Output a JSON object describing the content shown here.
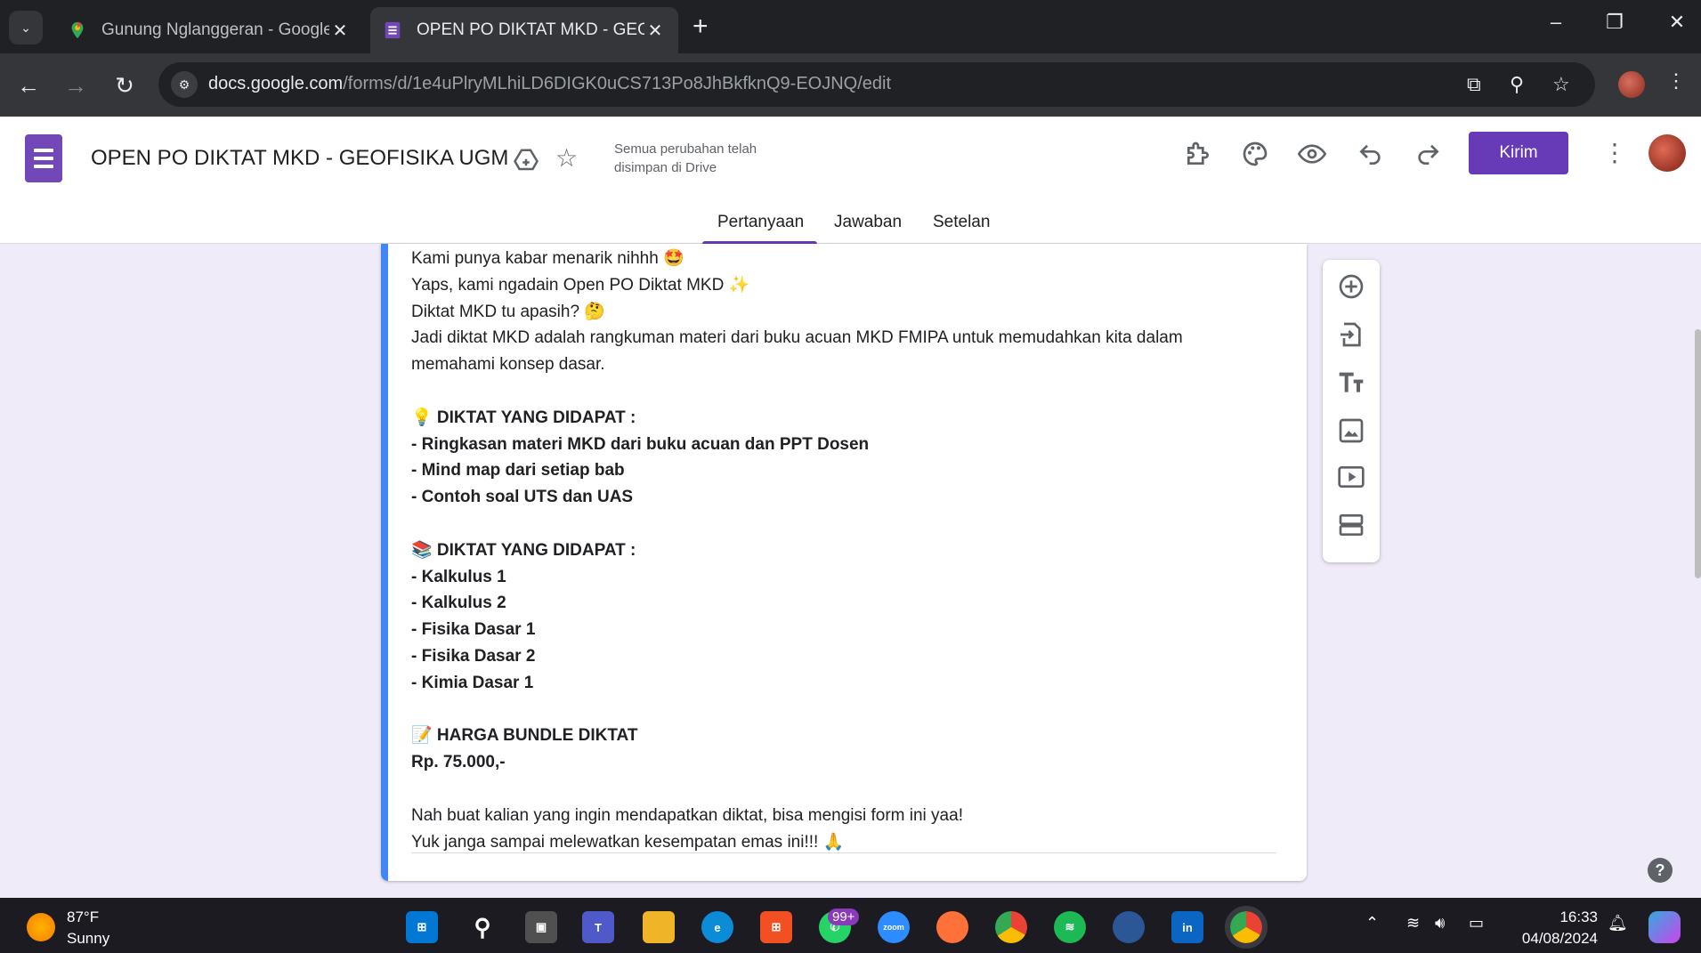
{
  "browser": {
    "tabs": [
      {
        "title": "Gunung Nglanggeran - Google",
        "active": false
      },
      {
        "title": "OPEN PO DIKTAT MKD - GEOFIS",
        "active": true
      }
    ],
    "url_host": "docs.google.com",
    "url_path": "/forms/d/1e4uPlryMLhiLD6DIGK0uCS713Po8JhBkfknQ9-EOJNQ/edit",
    "new_tab": "+",
    "win_controls": [
      "–",
      "❐",
      "✕"
    ]
  },
  "form": {
    "title": "OPEN PO DIKTAT MKD - GEOFISIKA UGM",
    "save_status": "Semua perubahan telah disimpan di Drive",
    "send_label": "Kirim",
    "tabs": [
      "Pertanyaan",
      "Jawaban",
      "Setelan"
    ],
    "active_tab": "Pertanyaan",
    "accent_color": "#673ab7",
    "description_lines": [
      {
        "text": "Kami punya kabar menarik nihhh 🤩",
        "bold": false
      },
      {
        "text": "Yaps, kami ngadain Open PO Diktat MKD ✨",
        "bold": false
      },
      {
        "text": "Diktat MKD tu apasih? 🤔",
        "bold": false
      },
      {
        "text": "Jadi diktat MKD adalah rangkuman materi dari buku acuan MKD FMIPA untuk memudahkan kita dalam",
        "bold": false
      },
      {
        "text": "memahami konsep dasar.",
        "bold": false
      },
      {
        "text": "",
        "bold": false
      },
      {
        "text": "💡 DIKTAT YANG DIDAPAT :",
        "bold": true
      },
      {
        "text": "- Ringkasan materi MKD dari buku acuan dan PPT Dosen",
        "bold": true
      },
      {
        "text": "- Mind map dari setiap bab",
        "bold": true
      },
      {
        "text": "- Contoh soal UTS dan UAS",
        "bold": true
      },
      {
        "text": "",
        "bold": false
      },
      {
        "text": "📚 DIKTAT YANG DIDAPAT :",
        "bold": true
      },
      {
        "text": "- Kalkulus 1",
        "bold": true
      },
      {
        "text": "- Kalkulus 2",
        "bold": true
      },
      {
        "text": "- Fisika Dasar 1",
        "bold": true
      },
      {
        "text": "- Fisika Dasar 2",
        "bold": true
      },
      {
        "text": "- Kimia Dasar 1",
        "bold": true
      },
      {
        "text": "",
        "bold": false
      },
      {
        "text": "📝 HARGA BUNDLE DIKTAT",
        "bold": true
      },
      {
        "text": "Rp. 75.000,-",
        "bold": true
      },
      {
        "text": "",
        "bold": false
      },
      {
        "text": "Nah buat kalian yang ingin mendapatkan diktat, bisa mengisi form ini yaa!",
        "bold": false
      },
      {
        "text": "Yuk janga sampai melewatkan kesempatan emas ini!!! 🙏",
        "bold": false
      }
    ],
    "sidebar_tools": [
      "add-question-icon",
      "import-questions-icon",
      "add-title-icon",
      "add-image-icon",
      "add-video-icon",
      "add-section-icon"
    ],
    "help": "?"
  },
  "taskbar": {
    "weather_temp": "87°F",
    "weather_desc": "Sunny",
    "whatsapp_badge": "99+",
    "time": "16:33",
    "date": "04/08/2024"
  }
}
